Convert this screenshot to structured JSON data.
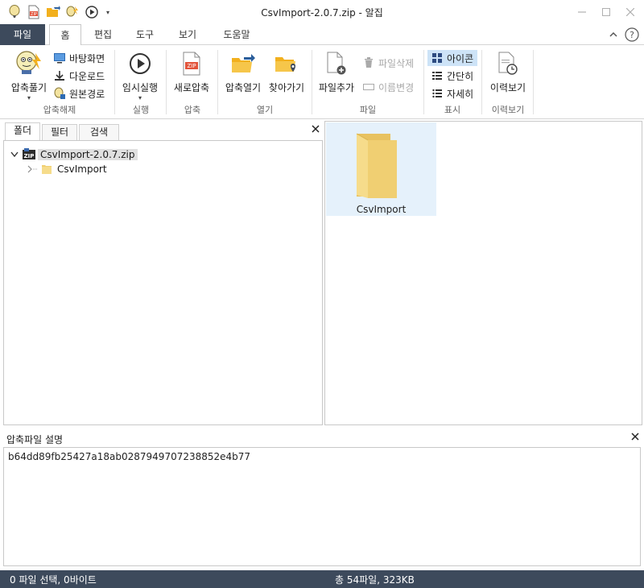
{
  "window": {
    "title": "CsvImport-2.0.7.zip - 알집"
  },
  "quick_access": {
    "icons": [
      "balloon-logo-icon",
      "zip-file-icon",
      "open-folder-icon",
      "extract-wizard-icon",
      "play-circle-icon",
      "dropdown-arrow-icon"
    ],
    "dropdown": "▾"
  },
  "menu": {
    "file": "파일",
    "tabs": [
      "홈",
      "편집",
      "도구",
      "보기",
      "도움말"
    ]
  },
  "ribbon": {
    "groups": {
      "extract": "압축해제",
      "run": "실행",
      "compress": "압축",
      "open": "열기",
      "file": "파일",
      "view": "표시",
      "history": "이력보기"
    },
    "extract_button": "압축풀기",
    "desktop": "바탕화면",
    "download": "다운로드",
    "original_path": "원본경로",
    "temp_run": "임시실행",
    "new_compress": "새로압축",
    "open_archive": "압축열기",
    "find": "찾아가기",
    "add_file": "파일추가",
    "delete_file": "파일삭제",
    "rename": "이름변경",
    "view_icon": "아이콘",
    "view_simple": "간단히",
    "view_detail": "자세히",
    "history": "이력보기",
    "dropdown": "▾"
  },
  "left_panel": {
    "tabs": [
      "폴더",
      "필터",
      "검색"
    ],
    "tree": {
      "root": "CsvImport-2.0.7.zip",
      "child": "CsvImport"
    }
  },
  "right_panel": {
    "items": [
      {
        "name": "CsvImport",
        "type": "folder"
      }
    ]
  },
  "description": {
    "title": "압축파일 설명",
    "text": "b64dd89fb25427a18ab0287949707238852e4b77"
  },
  "status": {
    "selection": "0 파일 선택,  0바이트",
    "total": "총 54파일,  323KB"
  },
  "colors": {
    "file_tab_bg": "#3d4a5c",
    "status_bg": "#3d4a5c",
    "selection_bg": "#e5f1fb",
    "view_selected_bg": "#cde3f7",
    "folder_yellow": "#f0cf72"
  }
}
